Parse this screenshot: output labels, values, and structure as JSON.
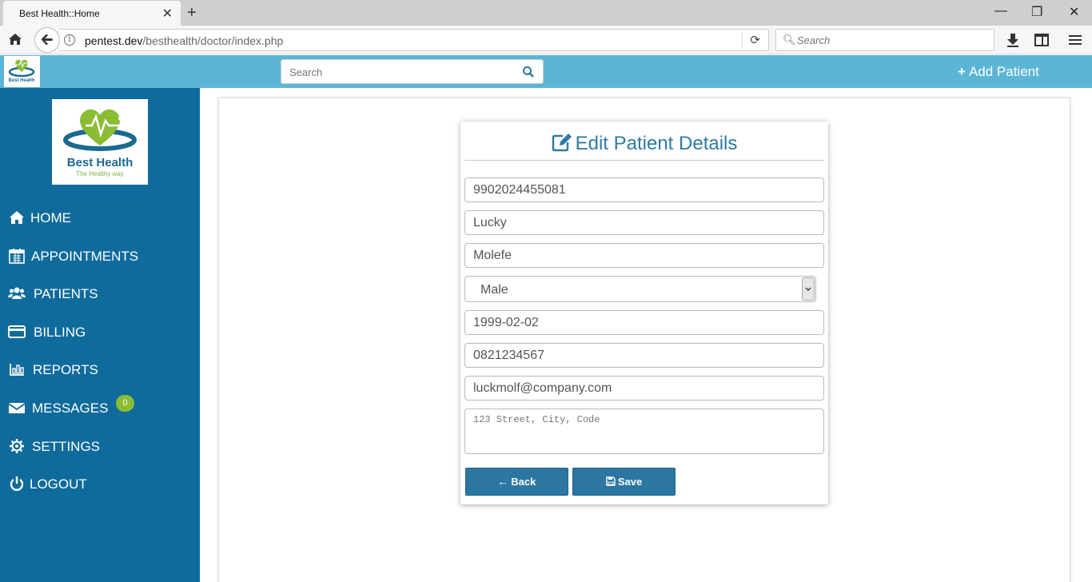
{
  "browser": {
    "tab_title": "Best Health::Home",
    "url_domain": "pentest.dev",
    "url_path": "/besthealth/doctor/index.php",
    "search_placeholder": "Search"
  },
  "header": {
    "search_placeholder": "Search",
    "add_patient_label": "Add Patient"
  },
  "brand": {
    "name": "Best Health",
    "tagline": "The Healthy way",
    "primary_color": "#0f6b9b",
    "header_color": "#5bb5d5",
    "accent_green": "#8bbd34"
  },
  "sidebar": {
    "items": [
      {
        "label": "HOME",
        "icon": "home-icon"
      },
      {
        "label": "APPOINTMENTS",
        "icon": "calendar-icon"
      },
      {
        "label": "PATIENTS",
        "icon": "users-icon"
      },
      {
        "label": "BILLING",
        "icon": "credit-card-icon"
      },
      {
        "label": "REPORTS",
        "icon": "bar-chart-icon"
      },
      {
        "label": "MESSAGES",
        "icon": "envelope-icon"
      },
      {
        "label": "SETTINGS",
        "icon": "gear-icon"
      },
      {
        "label": "LOGOUT",
        "icon": "power-icon"
      }
    ],
    "messages_badge": "0"
  },
  "form": {
    "title": "Edit Patient Details",
    "id_number": "9902024455081",
    "first_name": "Lucky",
    "last_name": "Molefe",
    "gender": "Male",
    "dob": "1999-02-02",
    "phone": "0821234567",
    "email": "luckmolf@company.com",
    "address_placeholder": "123 Street, City, Code",
    "back_label": "← Back",
    "save_label": "Save"
  }
}
